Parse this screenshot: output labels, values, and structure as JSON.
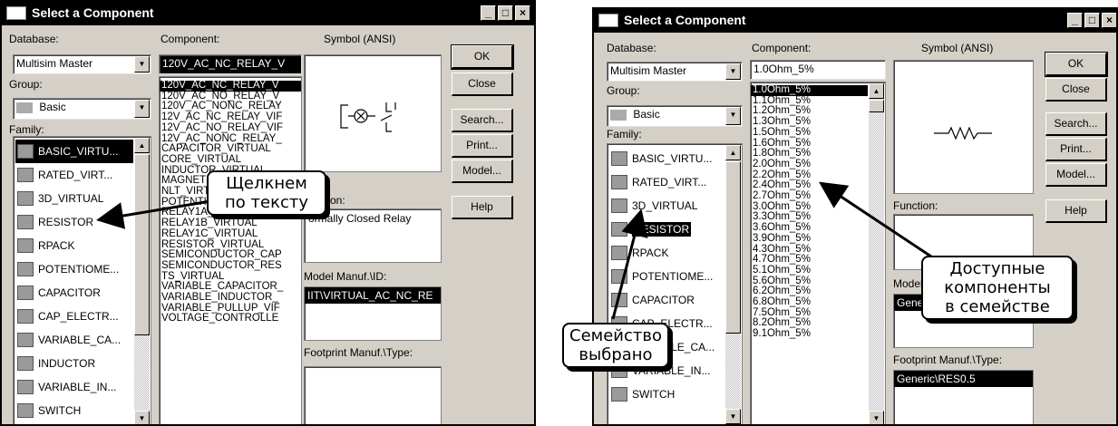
{
  "left": {
    "title": "Select a Component",
    "database_label": "Database:",
    "database_value": "Multisim Master",
    "group_label": "Group:",
    "group_value": "Basic",
    "family_label": "Family:",
    "component_label": "Component:",
    "component_value": "120V_AC_NC_RELAY_V",
    "symbol_label": "Symbol (ANSI)",
    "families": [
      "BASIC_VIRTU...",
      "RATED_VIRT...",
      "3D_VIRTUAL",
      "RESISTOR",
      "RPACK",
      "POTENTIOME...",
      "CAPACITOR",
      "CAP_ELECTR...",
      "VARIABLE_CA...",
      "INDUCTOR",
      "VARIABLE_IN...",
      "SWITCH"
    ],
    "components": [
      "120V_AC_NC_RELAY_V",
      "120V_AC_NO_RELAY_V",
      "120V_AC_NONC_RELAY",
      "12V_AC_NC_RELAY_VIF",
      "12V_AC_NO_RELAY_VIF",
      "12V_AC_NONC_RELAY_",
      "CAPACITOR_VIRTUAL",
      "CORE_VIRTUAL",
      "INDUCTOR_VIRTUAL",
      "MAGNETIC_CORE",
      "NLT_VIRTUAL",
      "POTENTIOMETER_VIRT",
      "RELAY1A_VIRTUAL",
      "RELAY1B_VIRTUAL",
      "RELAY1C_VIRTUAL",
      "RESISTOR_VIRTUAL",
      "SEMICONDUCTOR_CAP",
      "SEMICONDUCTOR_RES",
      "TS_VIRTUAL",
      "VARIABLE_CAPACITOR_",
      "VARIABLE_INDUCTOR_",
      "VARIABLE_PULLUP_VIF",
      "VOLTAGE_CONTROLLE"
    ],
    "function_label": "on:",
    "function_value": "ormally Closed Relay",
    "model_label": "Model Manuf.\\ID:",
    "model_value": "IIT\\VIRTUAL_AC_NC_RE",
    "footprint_label": "Footprint Manuf.\\Type:",
    "buttons": {
      "ok": "OK",
      "close": "Close",
      "search": "Search...",
      "print": "Print...",
      "model": "Model...",
      "help": "Help"
    },
    "callout": "Щелкнем\nпо тексту"
  },
  "right": {
    "title": "Select a Component",
    "database_label": "Database:",
    "database_value": "Multisim Master",
    "group_label": "Group:",
    "group_value": "Basic",
    "family_label": "Family:",
    "component_label": "Component:",
    "component_value": "1.0Ohm_5%",
    "symbol_label": "Symbol (ANSI)",
    "families": [
      "BASIC_VIRTU...",
      "RATED_VIRT...",
      "3D_VIRTUAL",
      "RESISTOR",
      "RPACK",
      "POTENTIOME...",
      "CAPACITOR",
      "CAP_ELECTR...",
      "VARIABLE_CA...",
      "VARIABLE_IN...",
      "SWITCH"
    ],
    "components": [
      "1.0Ohm_5%",
      "1.1Ohm_5%",
      "1.2Ohm_5%",
      "1.3Ohm_5%",
      "1.5Ohm_5%",
      "1.6Ohm_5%",
      "1.8Ohm_5%",
      "2.0Ohm_5%",
      "2.2Ohm_5%",
      "2.4Ohm_5%",
      "2.7Ohm_5%",
      "3.0Ohm_5%",
      "3.3Ohm_5%",
      "3.6Ohm_5%",
      "3.9Ohm_5%",
      "4.3Ohm_5%",
      "4.7Ohm_5%",
      "5.1Ohm_5%",
      "5.6Ohm_5%",
      "6.2Ohm_5%",
      "6.8Ohm_5%",
      "7.5Ohm_5%",
      "8.2Ohm_5%",
      "9.1Ohm_5%"
    ],
    "function_label": "Function:",
    "model_label": "Model M",
    "model_value": "Generic",
    "footprint_label": "Footprint Manuf.\\Type:",
    "footprint_value": "Generic\\RES0.5",
    "buttons": {
      "ok": "OK",
      "close": "Close",
      "search": "Search...",
      "print": "Print...",
      "model": "Model...",
      "help": "Help"
    },
    "callout_family": "Семейство\nвыбрано",
    "callout_available": "Доступные\nкомпоненты\nв семействе"
  },
  "colors": {
    "dialog": "#d4d0c8",
    "titlebar": "#000000",
    "selection": "#000000"
  }
}
